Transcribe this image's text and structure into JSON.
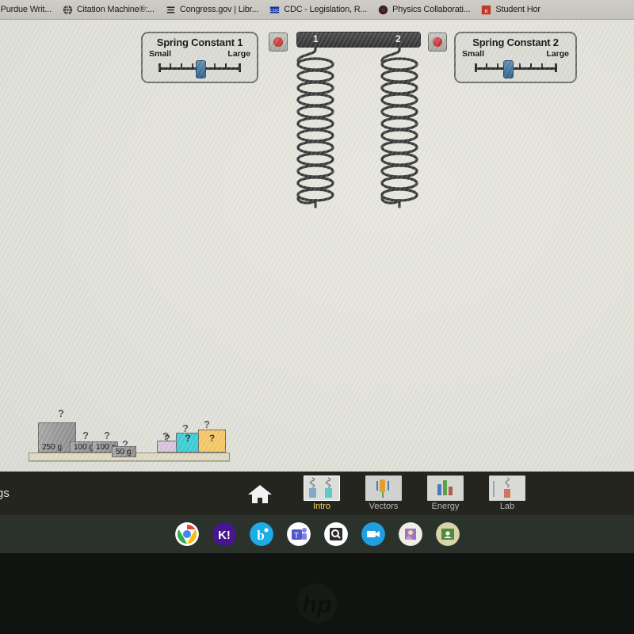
{
  "browser": {
    "bookmarks": [
      {
        "label": "// Purdue Writ...",
        "icon": "none-icon"
      },
      {
        "label": "Citation Machine®:...",
        "icon": "globe-icon"
      },
      {
        "label": "Congress.gov | Libr...",
        "icon": "congress-icon"
      },
      {
        "label": "CDC - Legislation, R...",
        "icon": "cdc-icon"
      },
      {
        "label": "Physics Collaborati...",
        "icon": "dark-circle-icon"
      },
      {
        "label": "Student Hor",
        "icon": "red-square-n-icon"
      }
    ]
  },
  "simulation": {
    "title_partial": "gs",
    "spring_panels": [
      {
        "title": "Spring Constant 1",
        "min_label": "Small",
        "max_label": "Large",
        "value_percent": 50,
        "tick_count": 8
      },
      {
        "title": "Spring Constant 2",
        "min_label": "Small",
        "max_label": "Large",
        "value_percent": 38,
        "tick_count": 8
      }
    ],
    "springs": [
      {
        "number": "1"
      },
      {
        "number": "2"
      }
    ],
    "reset_buttons": [
      {
        "name": "reset-spring-1",
        "color": "#c03030"
      },
      {
        "name": "reset-spring-2",
        "color": "#c03030"
      }
    ],
    "known_weights": [
      {
        "label": "250 g",
        "hook": "?",
        "color": "#a2a2a2"
      },
      {
        "label": "100 g",
        "hook": "?",
        "color": "#a2a2a2"
      },
      {
        "label": "100 g",
        "hook": "?",
        "color": "#a2a2a2"
      },
      {
        "label": "50 g",
        "hook": "?",
        "color": "#a2a2a2"
      }
    ],
    "mystery_weights": [
      {
        "label": "?",
        "hook": "?",
        "color": "#d9c3dd"
      },
      {
        "label": "?",
        "hook": "?",
        "color": "#3dcdd6"
      },
      {
        "label": "?",
        "hook": "?",
        "color": "#f5c濃"
      }
    ],
    "mystery_colors": [
      "#d9c3dd",
      "#3dcdd6",
      "#f6c866"
    ],
    "nav": {
      "home_label": "home-icon",
      "tabs": [
        {
          "label": "Intro",
          "active": true
        },
        {
          "label": "Vectors",
          "active": false
        },
        {
          "label": "Energy",
          "active": false
        },
        {
          "label": "Lab",
          "active": false
        }
      ]
    }
  },
  "taskbar": {
    "apps": [
      {
        "name": "chrome",
        "selected": true
      },
      {
        "name": "kahoot",
        "glyph": "K!",
        "selected": false
      },
      {
        "name": "brainpop",
        "glyph": "b",
        "selected": false
      },
      {
        "name": "microsoft-teams",
        "glyph": "T",
        "selected": false
      },
      {
        "name": "search-app",
        "glyph": "Q",
        "selected": false
      },
      {
        "name": "video-app",
        "glyph": "",
        "selected": false
      },
      {
        "name": "photo-app",
        "glyph": "",
        "selected": false
      },
      {
        "name": "google-classroom",
        "glyph": "",
        "selected": false
      }
    ]
  },
  "device": {
    "brand": "hp"
  }
}
